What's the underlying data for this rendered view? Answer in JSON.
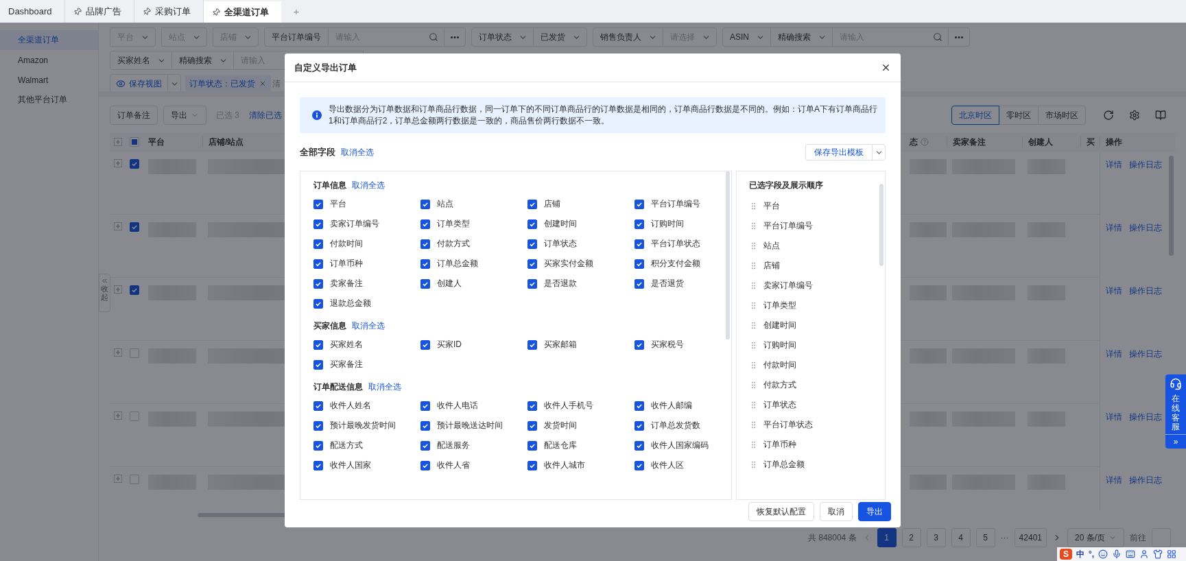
{
  "tabs": [
    {
      "label": "Dashboard",
      "pinned": false,
      "selected": false
    },
    {
      "label": "品牌广告",
      "pinned": true,
      "selected": false
    },
    {
      "label": "采购订单",
      "pinned": true,
      "selected": false
    },
    {
      "label": "全渠道订单",
      "pinned": true,
      "selected": true
    }
  ],
  "add_tab": "+",
  "sidebar": {
    "items": [
      {
        "label": "全渠道订单",
        "selected": true
      },
      {
        "label": "Amazon",
        "selected": false
      },
      {
        "label": "Walmart",
        "selected": false
      },
      {
        "label": "其他平台订单",
        "selected": false
      }
    ],
    "collapse_label": "收起"
  },
  "filter_rows": [
    {
      "groups": [
        {
          "segments": [
            {
              "kind": "select",
              "placeholder": "平台"
            }
          ]
        },
        {
          "segments": [
            {
              "kind": "select",
              "placeholder": "站点"
            }
          ]
        },
        {
          "segments": [
            {
              "kind": "select",
              "placeholder": "店铺"
            }
          ]
        },
        {
          "segments": [
            {
              "kind": "label",
              "text": "平台订单编号"
            },
            {
              "kind": "search",
              "placeholder": "请输入"
            },
            {
              "kind": "more"
            }
          ]
        },
        {
          "segments": [
            {
              "kind": "select",
              "value": "订单状态"
            },
            {
              "kind": "select",
              "value": "已发货"
            }
          ]
        },
        {
          "segments": [
            {
              "kind": "select",
              "value": "销售负责人"
            },
            {
              "kind": "select",
              "placeholder": "请选择"
            }
          ]
        },
        {
          "segments": [
            {
              "kind": "select",
              "value": "ASIN"
            },
            {
              "kind": "select",
              "value": "精确搜索"
            },
            {
              "kind": "search",
              "placeholder": "请输入"
            },
            {
              "kind": "more"
            }
          ]
        }
      ]
    },
    {
      "groups": [
        {
          "segments": [
            {
              "kind": "select",
              "value": "买家姓名"
            },
            {
              "kind": "select",
              "value": "精确搜索"
            },
            {
              "kind": "input",
              "placeholder": "请输入"
            }
          ]
        }
      ]
    }
  ],
  "view_bar": {
    "save_view": "保存视图",
    "tags": [
      "订单状态：已发货"
    ],
    "cut_text": "清"
  },
  "toolbar": {
    "buttons": [
      {
        "label": "订单备注",
        "kind": "button"
      },
      {
        "label": "导出",
        "kind": "dropdown"
      }
    ],
    "selected_count": "已选 3",
    "clear_link": "清除已选",
    "timezones": [
      {
        "label": "北京时区",
        "selected": true
      },
      {
        "label": "零时区",
        "selected": false
      },
      {
        "label": "市场时区",
        "selected": false
      }
    ]
  },
  "table": {
    "header_partial": true,
    "columns_left": [
      "平台",
      "店铺/站点"
    ],
    "columns_right": [
      {
        "label": "态",
        "help": true
      },
      {
        "label": "卖家备注",
        "help": false
      },
      {
        "label": "创建人",
        "help": false
      },
      {
        "label": "买",
        "help": false
      },
      {
        "label": "操作",
        "help": false
      }
    ],
    "rows": [
      {
        "checked": true,
        "actions": [
          "详情",
          "操作日志"
        ]
      },
      {
        "checked": true,
        "actions": [
          "详情",
          "操作日志"
        ]
      },
      {
        "checked": true,
        "actions": [
          "详情",
          "操作日志"
        ]
      },
      {
        "checked": false,
        "actions": [
          "详情",
          "操作日志"
        ]
      },
      {
        "checked": false,
        "actions": [
          "详情",
          "操作日志"
        ]
      },
      {
        "checked": false,
        "actions": [
          "详情",
          "操作日志"
        ]
      }
    ]
  },
  "pagination": {
    "total": "共 848004 条",
    "pages": [
      {
        "label": "1",
        "selected": true
      },
      {
        "label": "2",
        "selected": false
      },
      {
        "label": "3",
        "selected": false
      },
      {
        "label": "4",
        "selected": false
      },
      {
        "label": "5",
        "selected": false
      }
    ],
    "ellipsis": "···",
    "last_page": "42401",
    "page_size": "20 条/页",
    "goto_label": "前往"
  },
  "support": {
    "label": "在线客服",
    "expand": "»"
  },
  "ime": {
    "logo": "S",
    "mode": "中",
    "punct": "°,"
  },
  "modal": {
    "title": "自定义导出订单",
    "notice": "导出数据分为订单数据和订单商品行数据，同一订单下的不同订单商品行的订单数据是相同的，订单商品行数据是不同的。例如：订单A下有订单商品行1和订单商品行2，订单总金额两行数据是一致的，商品售价两行数据不一致。",
    "all_fields_label": "全部字段",
    "deselect_all": "取消全选",
    "template_button": "保存导出模板",
    "groups": [
      {
        "title": "订单信息",
        "toggle": "取消全选",
        "fields": [
          {
            "label": "平台",
            "checked": true
          },
          {
            "label": "站点",
            "checked": true
          },
          {
            "label": "店铺",
            "checked": true
          },
          {
            "label": "平台订单编号",
            "checked": true
          },
          {
            "label": "卖家订单编号",
            "checked": true
          },
          {
            "label": "订单类型",
            "checked": true
          },
          {
            "label": "创建时间",
            "checked": true
          },
          {
            "label": "订购时间",
            "checked": true
          },
          {
            "label": "付款时间",
            "checked": true
          },
          {
            "label": "付款方式",
            "checked": true
          },
          {
            "label": "订单状态",
            "checked": true
          },
          {
            "label": "平台订单状态",
            "checked": true
          },
          {
            "label": "订单币种",
            "checked": true
          },
          {
            "label": "订单总金额",
            "checked": true
          },
          {
            "label": "买家实付金额",
            "checked": true
          },
          {
            "label": "积分支付金额",
            "checked": true
          },
          {
            "label": "卖家备注",
            "checked": true
          },
          {
            "label": "创建人",
            "checked": true
          },
          {
            "label": "是否退款",
            "checked": true
          },
          {
            "label": "是否退货",
            "checked": true
          },
          {
            "label": "退款总金额",
            "checked": true
          }
        ]
      },
      {
        "title": "买家信息",
        "toggle": "取消全选",
        "fields": [
          {
            "label": "买家姓名",
            "checked": true
          },
          {
            "label": "买家ID",
            "checked": true
          },
          {
            "label": "买家邮箱",
            "checked": true
          },
          {
            "label": "买家税号",
            "checked": true
          },
          {
            "label": "买家备注",
            "checked": true
          }
        ]
      },
      {
        "title": "订单配送信息",
        "toggle": "取消全选",
        "fields": [
          {
            "label": "收件人姓名",
            "checked": true
          },
          {
            "label": "收件人电话",
            "checked": true
          },
          {
            "label": "收件人手机号",
            "checked": true
          },
          {
            "label": "收件人邮编",
            "checked": true
          },
          {
            "label": "预计最晚发货时间",
            "checked": true
          },
          {
            "label": "预计最晚送达时间",
            "checked": true
          },
          {
            "label": "发货时间",
            "checked": true
          },
          {
            "label": "订单总发货数",
            "checked": true
          },
          {
            "label": "配送方式",
            "checked": true
          },
          {
            "label": "配送服务",
            "checked": true
          },
          {
            "label": "配送仓库",
            "checked": true
          },
          {
            "label": "收件人国家编码",
            "checked": true
          },
          {
            "label": "收件人国家",
            "checked": true
          },
          {
            "label": "收件人省",
            "checked": true
          },
          {
            "label": "收件人城市",
            "checked": true
          },
          {
            "label": "收件人区",
            "checked": true
          }
        ]
      }
    ],
    "selected_title": "已选字段及展示顺序",
    "selected_fields": [
      "平台",
      "平台订单编号",
      "站点",
      "店铺",
      "卖家订单编号",
      "订单类型",
      "创建时间",
      "订购时间",
      "付款时间",
      "付款方式",
      "订单状态",
      "平台订单状态",
      "订单币种",
      "订单总金额"
    ],
    "footer_buttons": [
      {
        "label": "恢复默认配置",
        "primary": false
      },
      {
        "label": "取消",
        "primary": false
      },
      {
        "label": "导出",
        "primary": true
      }
    ]
  }
}
